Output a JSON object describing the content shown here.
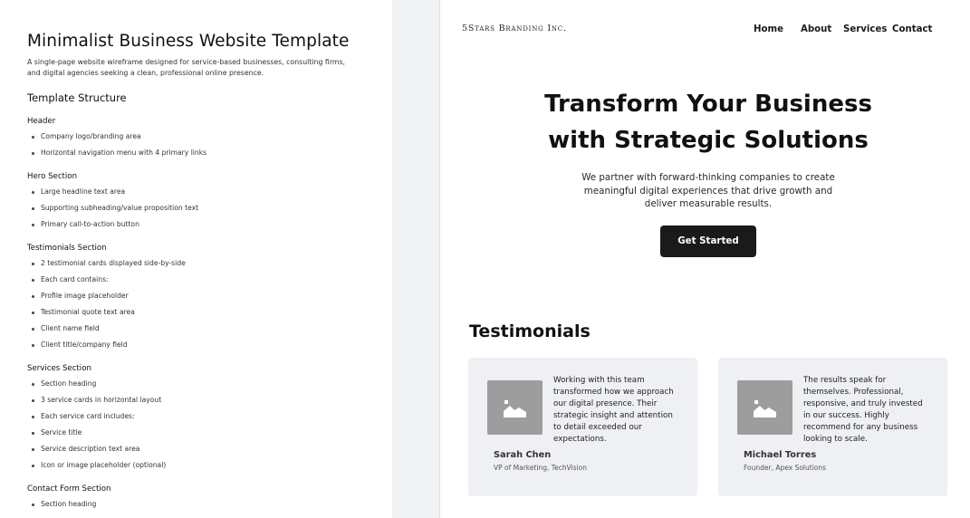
{
  "document": {
    "title": "Minimalist Business Website Template",
    "description": "A single-page website wireframe designed for service-based businesses, consulting firms, and digital agencies seeking a clean, professional online presence.",
    "structure_heading": "Template Structure",
    "sections": [
      {
        "heading": "Header",
        "items": [
          "Company logo/branding area",
          "Horizontal navigation menu with 4 primary links"
        ]
      },
      {
        "heading": "Hero Section",
        "items": [
          "Large headline text area",
          "Supporting subheading/value proposition text",
          "Primary call-to-action button"
        ]
      },
      {
        "heading": "Testimonials Section",
        "items": [
          "2 testimonial cards displayed side-by-side",
          "Each card contains:",
          "Profile image placeholder",
          "Testimonial quote text area",
          "Client name field",
          "Client title/company field"
        ]
      },
      {
        "heading": "Services Section",
        "items": [
          "Section heading",
          "3 service cards in horizontal layout",
          "Each service card includes:",
          "Service title",
          "Service description text area",
          "Icon or image placeholder (optional)"
        ]
      },
      {
        "heading": "Contact Form Section",
        "items": [
          "Section heading"
        ]
      }
    ]
  },
  "site": {
    "brand": "5Stars Branding Inc.",
    "nav": [
      "Home",
      "About",
      "Services",
      "Contact"
    ],
    "hero": {
      "title_line1": "Transform Your Business",
      "title_line2": "with Strategic Solutions",
      "subtitle": "We partner with forward-thinking companies to create meaningful digital experiences that drive growth and deliver measurable results.",
      "cta": "Get Started"
    },
    "testimonials": {
      "heading": "Testimonials",
      "cards": [
        {
          "quote": "Working with this team transformed how we approach our digital presence. Their strategic insight and attention to detail exceeded our expectations.",
          "name": "Sarah Chen",
          "role": "VP of Marketing, TechVision"
        },
        {
          "quote": "The results speak for themselves. Professional, responsive, and truly invested in our success. Highly recommend for any business looking to scale.",
          "name": "Michael Torres",
          "role": "Founder, Apex Solutions"
        }
      ]
    }
  },
  "colors": {
    "button_bg": "#1a1a1a",
    "card_bg": "#eef0f3",
    "placeholder_bg": "#9d9d9d",
    "gutter_bg": "#f1f2f4"
  },
  "icons": {
    "placeholder": "image-placeholder-icon"
  }
}
